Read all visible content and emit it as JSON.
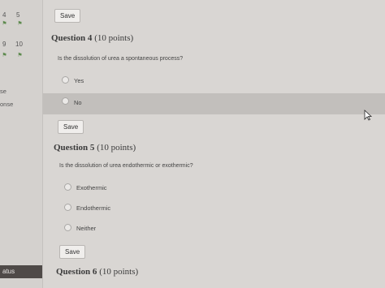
{
  "sidebar": {
    "question_numbers": [
      "4",
      "5",
      "9",
      "10"
    ],
    "labels": [
      "se",
      "onse"
    ],
    "status": "atus"
  },
  "questions": [
    {
      "title": "Question 4",
      "points": "(10 points)",
      "text": "Is the dissolution of urea a spontaneous process?",
      "options": [
        "Yes",
        "No"
      ],
      "highlighted_option": "No"
    },
    {
      "title": "Question 5",
      "points": "(10 points)",
      "text": "Is the dissolution of urea endothermic or exothermic?",
      "options": [
        "Exothermic",
        "Endothermic",
        "Neither"
      ]
    },
    {
      "title": "Question 6",
      "points": "(10 points)"
    }
  ],
  "buttons": {
    "save": "Save"
  },
  "icons": {
    "flag": "flag-icon",
    "cursor": "mouse-pointer-icon",
    "radio": "radio-button"
  }
}
